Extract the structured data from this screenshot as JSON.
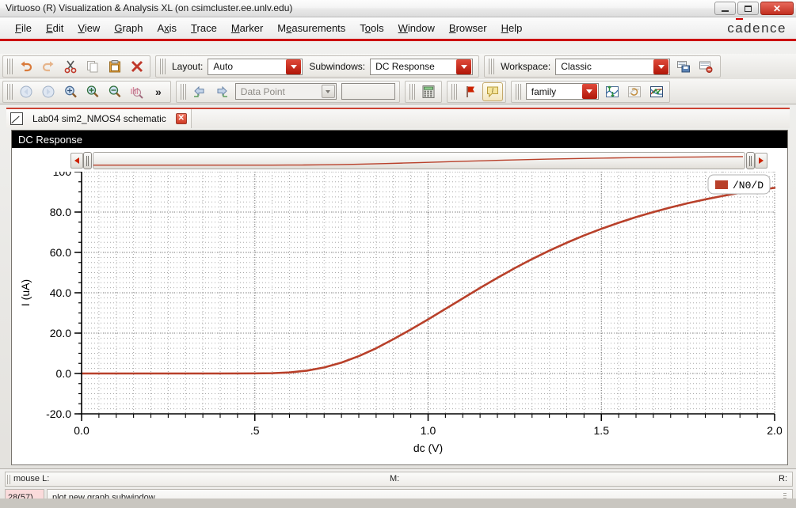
{
  "window": {
    "title": "Virtuoso (R) Visualization & Analysis XL (on csimcluster.ee.unlv.edu)",
    "minimize_label": "",
    "maximize_label": "",
    "close_label": "✕",
    "brand": "cadence"
  },
  "menubar": {
    "items": [
      {
        "label": "File",
        "mnemonic": "F"
      },
      {
        "label": "Edit",
        "mnemonic": "E"
      },
      {
        "label": "View",
        "mnemonic": "V"
      },
      {
        "label": "Graph",
        "mnemonic": "G"
      },
      {
        "label": "Axis",
        "mnemonic": "x"
      },
      {
        "label": "Trace",
        "mnemonic": "T"
      },
      {
        "label": "Marker",
        "mnemonic": "M"
      },
      {
        "label": "Measurements",
        "mnemonic": "e"
      },
      {
        "label": "Tools",
        "mnemonic": "o"
      },
      {
        "label": "Window",
        "mnemonic": "W"
      },
      {
        "label": "Browser",
        "mnemonic": "B"
      },
      {
        "label": "Help",
        "mnemonic": "H"
      }
    ]
  },
  "toolbar_row1": {
    "buttons": [
      {
        "name": "undo-icon",
        "title": "Undo"
      },
      {
        "name": "redo-icon",
        "title": "Redo"
      },
      {
        "name": "cut-icon",
        "title": "Cut"
      },
      {
        "name": "copy-icon",
        "title": "Copy"
      },
      {
        "name": "paste-icon",
        "title": "Paste"
      },
      {
        "name": "delete-icon",
        "title": "Delete"
      }
    ],
    "layout_label": "Layout:",
    "layout_value": "Auto",
    "subwindows_label": "Subwindows:",
    "subwindows_value": "DC Response",
    "workspace_label": "Workspace:",
    "workspace_value": "Classic",
    "save_workspace_icon": "save-workspace-icon",
    "delete_workspace_icon": "delete-workspace-icon"
  },
  "toolbar_row2": {
    "buttons": [
      {
        "name": "back-icon",
        "title": "Back"
      },
      {
        "name": "forward-icon",
        "title": "Forward"
      },
      {
        "name": "zoom-fit-icon",
        "title": "Zoom Fit"
      },
      {
        "name": "zoom-in-icon",
        "title": "Zoom In"
      },
      {
        "name": "zoom-out-icon",
        "title": "Zoom Out"
      },
      {
        "name": "zoom-waveform-icon",
        "title": "Zoom Waveform"
      }
    ],
    "overflow_label": "»",
    "prev_icon": "prev-marker-icon",
    "next_icon": "next-marker-icon",
    "marker_mode_value": "Data Point",
    "marker_text_value": "",
    "calculator_icon": "calculator-icon",
    "flag_icon": "flag-icon",
    "info_icon": "info-balloon-icon",
    "family_value": "family",
    "strip_icon": "strip-chart-icon",
    "swap_icon": "swap-axes-icon",
    "crossplot_icon": "cross-plot-icon"
  },
  "tab": {
    "label": "Lab04 sim2_NMOS4 schematic",
    "close_label": "✕",
    "icon": "schematic-icon"
  },
  "graph": {
    "title": "DC Response",
    "scroll_left_label": "",
    "scroll_right_label": ""
  },
  "statusbar": {
    "mouse_label": "mouse L:",
    "middle_label": "M:",
    "right_label": "R:",
    "count": "28(57)",
    "message": "plot new graph subwindow"
  },
  "colors": {
    "trace": "#b8402a",
    "accent_red": "#cc0000",
    "graph_title_bg": "#000000",
    "plot_bg": "#ffffff",
    "grid": "#b5b5b5"
  },
  "chart_data": {
    "type": "line",
    "title": "DC Response",
    "xlabel": "dc (V)",
    "ylabel": "I (uA)",
    "xlim": [
      0.0,
      2.0
    ],
    "ylim": [
      -20.0,
      100.0
    ],
    "xticks": [
      0.0,
      0.5,
      1.0,
      1.5,
      2.0
    ],
    "xticklabels": [
      "0.0",
      ".5",
      "1.0",
      "1.5",
      "2.0"
    ],
    "yticks": [
      -20.0,
      0.0,
      20.0,
      40.0,
      60.0,
      80.0,
      100.0
    ],
    "yticklabels": [
      "-20.0",
      "0.0",
      "20.0",
      "40.0",
      "60.0",
      "80.0",
      "100"
    ],
    "grid": true,
    "legend_position": "top-right",
    "series": [
      {
        "name": "/N0/D",
        "color": "#b8402a",
        "x": [
          0.0,
          0.1,
          0.2,
          0.3,
          0.4,
          0.5,
          0.55,
          0.6,
          0.65,
          0.7,
          0.75,
          0.8,
          0.85,
          0.9,
          0.95,
          1.0,
          1.05,
          1.1,
          1.15,
          1.2,
          1.25,
          1.3,
          1.35,
          1.4,
          1.45,
          1.5,
          1.55,
          1.6,
          1.65,
          1.7,
          1.75,
          1.8,
          1.85,
          1.9,
          1.95,
          2.0
        ],
        "y": [
          0.0,
          0.0,
          0.0,
          0.0,
          0.0,
          0.05,
          0.15,
          0.5,
          1.4,
          3.0,
          5.4,
          8.6,
          12.5,
          17.0,
          21.8,
          26.8,
          32.0,
          37.2,
          42.4,
          47.4,
          52.2,
          56.7,
          60.9,
          64.8,
          68.4,
          71.7,
          74.7,
          77.5,
          80.0,
          82.3,
          84.4,
          86.3,
          88.0,
          89.5,
          90.8,
          92.0
        ]
      }
    ]
  }
}
